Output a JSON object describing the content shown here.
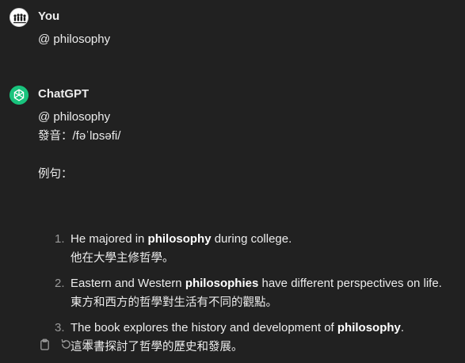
{
  "user_message": {
    "author": "You",
    "text": "@ philosophy",
    "avatar_icon": "user-avatar-icon"
  },
  "assistant_message": {
    "author": "ChatGPT",
    "avatar_icon": "openai-logo-icon",
    "avatar_color": "#19c37d",
    "line1": "@ philosophy",
    "pronunciation_label": "發音：",
    "pronunciation": "/fəˈlɒsəfi/",
    "examples_label": "例句：",
    "examples": [
      {
        "number": "1.",
        "pre": "He majored in ",
        "bold": "philosophy",
        "post": " during college.",
        "translation": "他在大學主修哲學。"
      },
      {
        "number": "2.",
        "pre": "Eastern and Western ",
        "bold": "philosophies",
        "post": " have different perspectives on life.",
        "translation": "東方和西方的哲學對生活有不同的觀點。"
      },
      {
        "number": "3.",
        "pre": "The book explores the history and development of ",
        "bold": "philosophy",
        "post": ".",
        "translation": "這本書探討了哲學的歷史和發展。"
      }
    ]
  },
  "actions": [
    {
      "name": "copy-button",
      "icon": "clipboard-icon"
    },
    {
      "name": "regenerate-button",
      "icon": "refresh-icon"
    },
    {
      "name": "thumbs-down-button",
      "icon": "thumbs-down-icon"
    }
  ],
  "colors": {
    "background": "#212121",
    "text": "#ececec",
    "muted": "#9b9b9b"
  }
}
